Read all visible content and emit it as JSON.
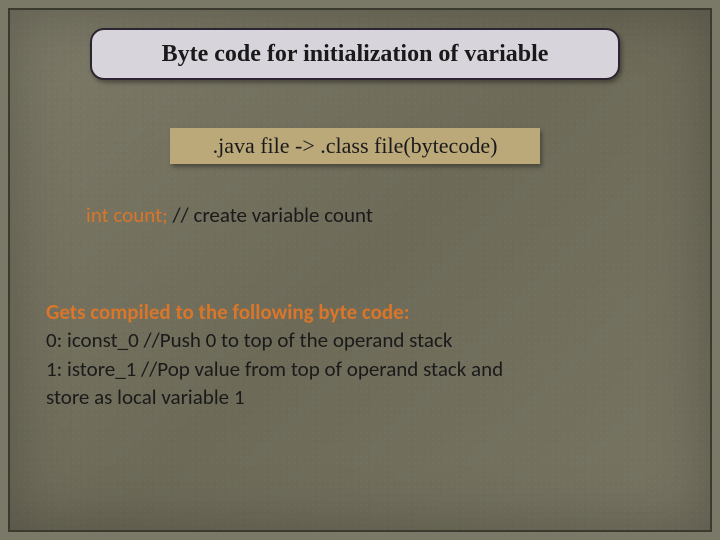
{
  "title": "Byte code for initialization of variable",
  "subtitle": ".java file  ->  .class file(bytecode)",
  "code": {
    "snippet": "int count;",
    "comment": " // create variable count"
  },
  "bytecode": {
    "heading": "Gets compiled to the following byte code:",
    "line0": "0: iconst_0  //Push 0 to top of the operand stack",
    "line1a": "1: istore_1  //Pop value from top of operand stack and",
    "line1b": "store as local variable 1"
  }
}
